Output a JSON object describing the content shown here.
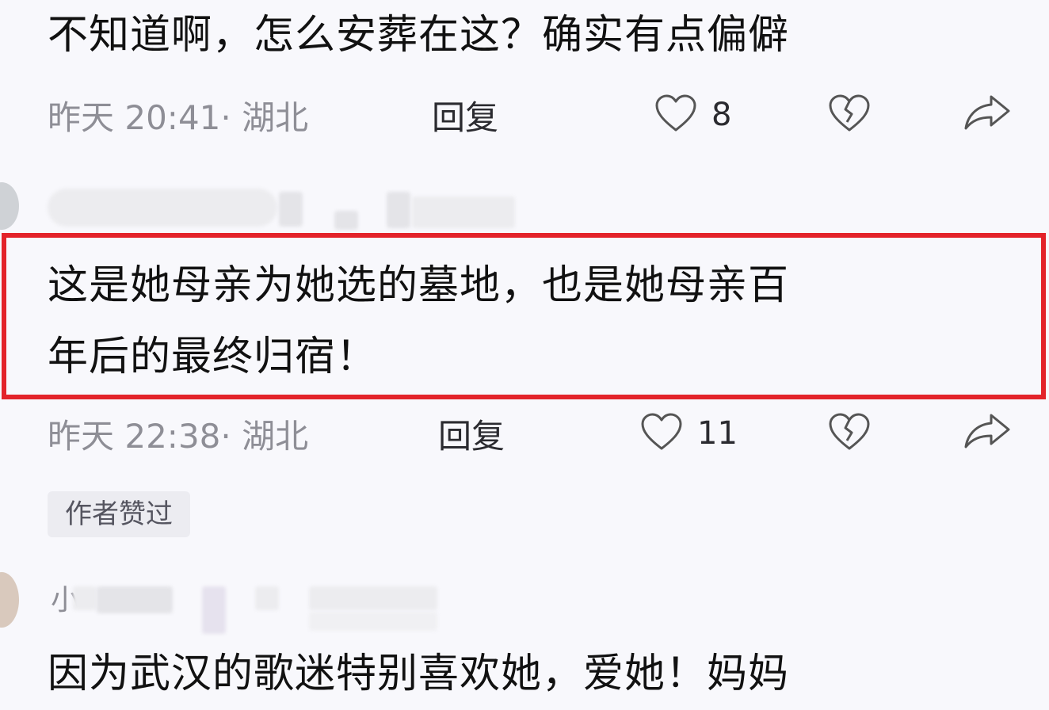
{
  "comments": [
    {
      "text_lines": [
        "不知道啊，怎么安葬在这？确实有点偏僻"
      ],
      "meta": "昨天 20:41· 湖北",
      "reply_label": "回复",
      "likes": "8"
    },
    {
      "text_lines": [
        "这是她母亲为她选的墓地，也是她母亲百",
        "年后的最终归宿！"
      ],
      "meta": "昨天 22:38· 湖北",
      "reply_label": "回复",
      "likes": "11",
      "badge": "作者赞过"
    },
    {
      "username_visible": "小",
      "text_lines": [
        "因为武汉的歌迷特别喜欢她，爱她！妈妈"
      ]
    }
  ],
  "colors": {
    "highlight_border": "#e3232a",
    "background": "#f8f8fc"
  },
  "icons": {
    "like": "heart-outline-icon",
    "dislike": "broken-heart-icon",
    "share": "share-arrow-icon"
  }
}
